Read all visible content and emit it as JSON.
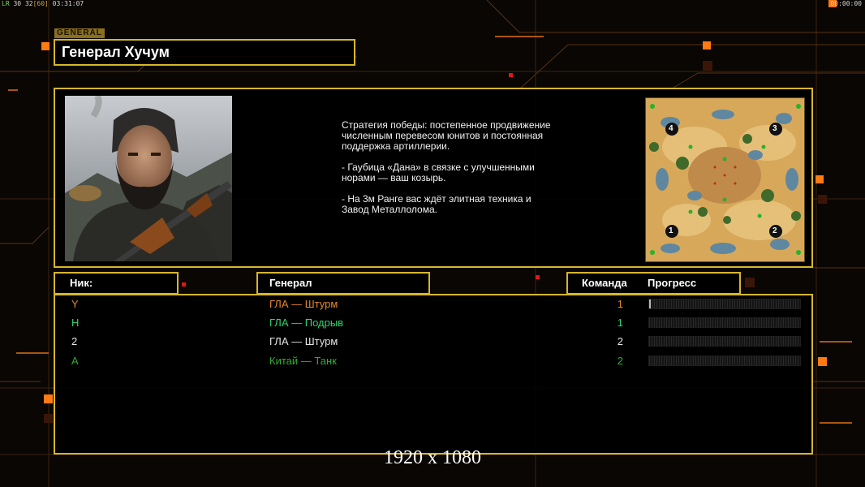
{
  "hud": {
    "fps_prefix": "LR",
    "fps_a": "30",
    "fps_b": "32",
    "fps_c": "[60]",
    "time_left": "03:31:07",
    "time_right": "00:00:00"
  },
  "header": {
    "tag": "GENERAL",
    "title": "Генерал Хучум"
  },
  "general_info": {
    "description": [
      "Стратегия победы: постепенное продвижение численным перевесом юнитов и постоянная поддержка артиллерии.",
      "- Гаубица «Дана» в связке с улучшенными норами — ваш козырь.",
      "- На 3м Ранге вас ждёт элитная техника и Завод Металлолома."
    ],
    "portrait_icon": "general-portrait",
    "minimap": {
      "icon": "minimap",
      "start_positions": [
        "4",
        "3",
        "1",
        "2"
      ]
    }
  },
  "columns": {
    "nick": "Ник:",
    "general": "Генерал",
    "team": "Команда",
    "progress": "Прогресс"
  },
  "players": [
    {
      "nick": "Y",
      "general": "ГЛА — Штурм",
      "team": "1",
      "color": "#e8872a",
      "progress": 0.01
    },
    {
      "nick": "Н",
      "general": "ГЛА — Подрыв",
      "team": "1",
      "color": "#2fd46e",
      "progress": 0
    },
    {
      "nick": "2",
      "general": "ГЛА — Штурм",
      "team": "2",
      "color": "#e6e6e6",
      "progress": 0
    },
    {
      "nick": "А",
      "general": "Китай — Танк",
      "team": "2",
      "color": "#2fb02f",
      "progress": 0
    }
  ],
  "resolution_label": "1920 x 1080",
  "colors": {
    "accent": "#d7b728",
    "background": "#090604",
    "grid_lines": "#3a2410",
    "deco_squares": "#ff7a10"
  }
}
